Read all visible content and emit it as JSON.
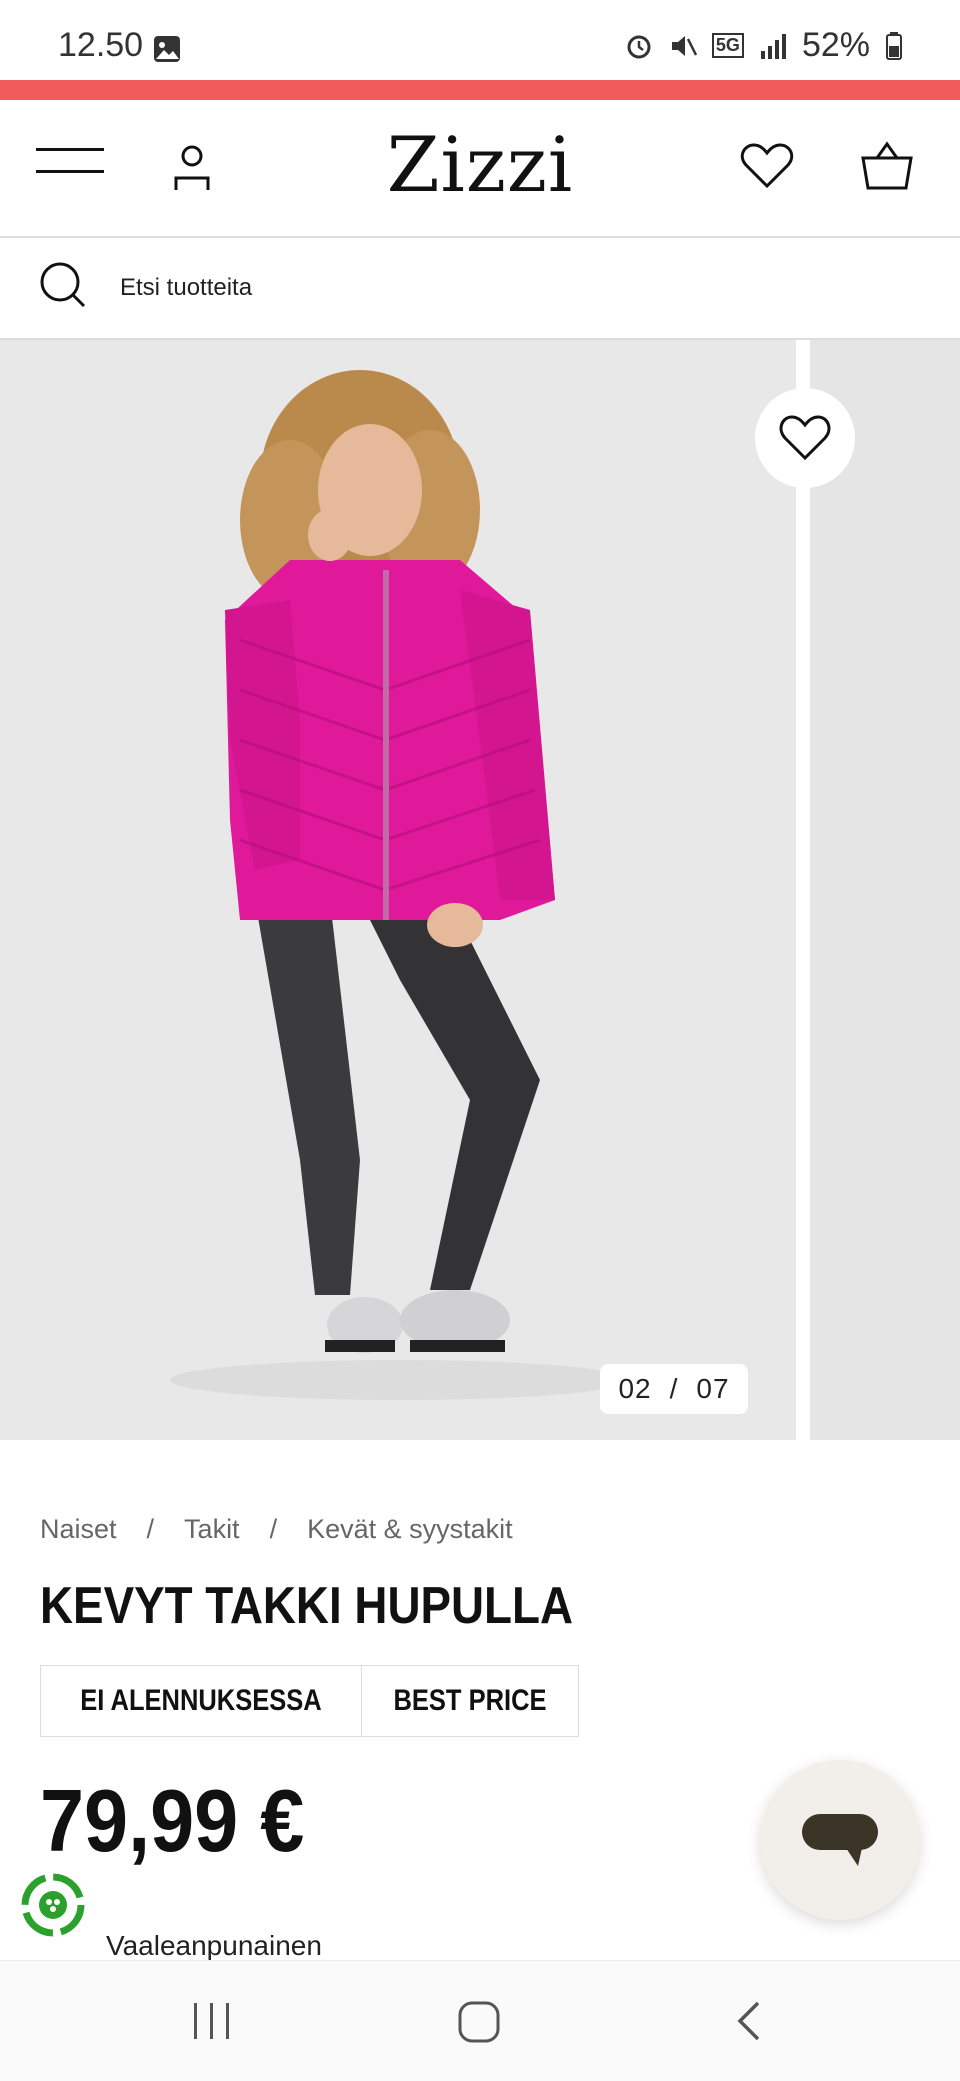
{
  "status_bar": {
    "time": "12.50",
    "network": "5G",
    "battery": "52%"
  },
  "header": {
    "logo": "Zizzi"
  },
  "search": {
    "placeholder": "Etsi tuotteita"
  },
  "gallery": {
    "current": "02",
    "separator": "/",
    "total": "07"
  },
  "product": {
    "breadcrumb": [
      "Naiset",
      "/",
      "Takit",
      "/",
      "Kevät & syystakit"
    ],
    "title": "KEVYT TAKKI HUPULLA",
    "badges": [
      "EI ALENNUKSESSA",
      "BEST PRICE"
    ],
    "price": "79,99 €",
    "color": "Vaaleanpunainen"
  },
  "colors": {
    "accent_strip": "#f25b5b",
    "jacket": "#e0199b"
  }
}
